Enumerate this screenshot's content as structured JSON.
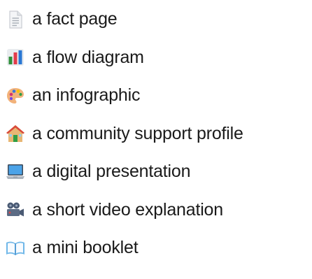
{
  "items": [
    {
      "label": "a fact page",
      "icon": "page-facing-up-icon"
    },
    {
      "label": "a flow diagram",
      "icon": "bar-chart-icon"
    },
    {
      "label": "an infographic",
      "icon": "artist-palette-icon"
    },
    {
      "label": "a community support profile",
      "icon": "house-icon"
    },
    {
      "label": "a digital presentation",
      "icon": "laptop-icon"
    },
    {
      "label": "a short video explanation",
      "icon": "movie-camera-icon"
    },
    {
      "label": "a mini booklet",
      "icon": "open-book-icon"
    }
  ]
}
